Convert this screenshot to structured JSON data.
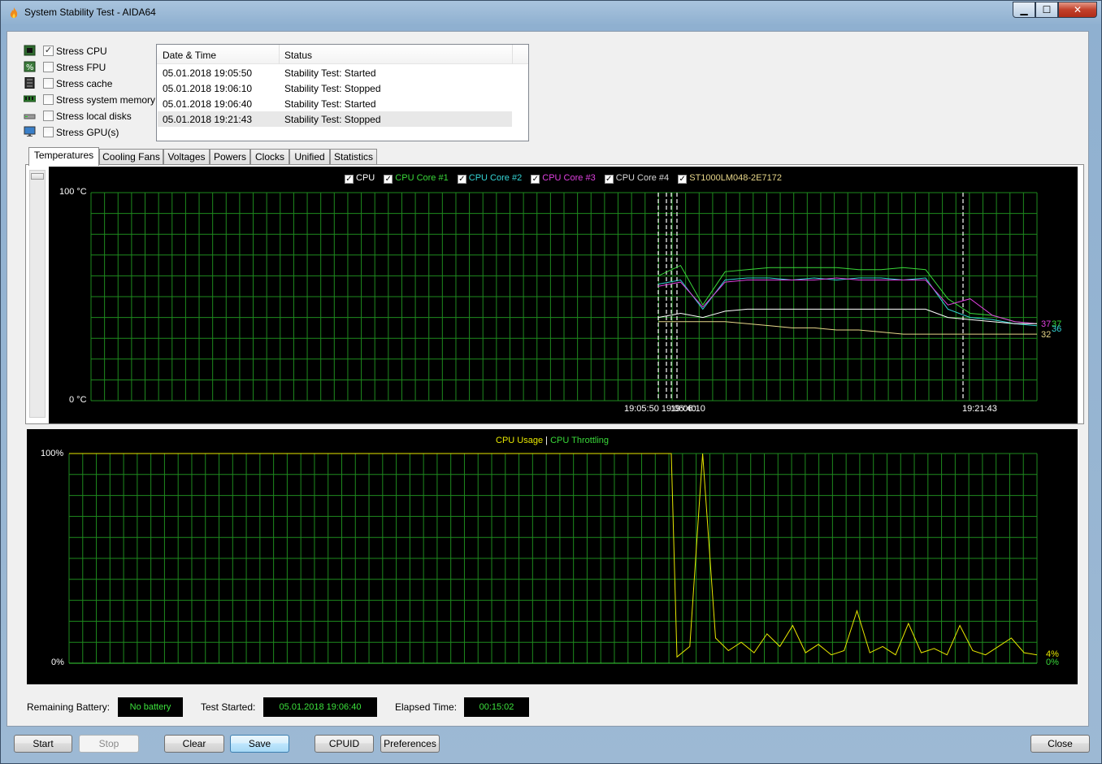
{
  "window": {
    "title": "System Stability Test - AIDA64",
    "controls": {
      "minimize": "▁",
      "maximize": "☐",
      "close": "✕"
    }
  },
  "stress_options": [
    {
      "label": "Stress CPU",
      "checked": true,
      "icon": "cpu-chip-icon"
    },
    {
      "label": "Stress FPU",
      "checked": false,
      "icon": "fpu-icon"
    },
    {
      "label": "Stress cache",
      "checked": false,
      "icon": "cache-icon"
    },
    {
      "label": "Stress system memory",
      "checked": false,
      "icon": "memory-module-icon"
    },
    {
      "label": "Stress local disks",
      "checked": false,
      "icon": "disk-drive-icon"
    },
    {
      "label": "Stress GPU(s)",
      "checked": false,
      "icon": "monitor-gpu-icon"
    }
  ],
  "log": {
    "columns": [
      "Date & Time",
      "Status"
    ],
    "rows": [
      {
        "datetime": "05.01.2018 19:05:50",
        "status": "Stability Test: Started"
      },
      {
        "datetime": "05.01.2018 19:06:10",
        "status": "Stability Test: Stopped"
      },
      {
        "datetime": "05.01.2018 19:06:40",
        "status": "Stability Test: Started"
      },
      {
        "datetime": "05.01.2018 19:21:43",
        "status": "Stability Test: Stopped"
      }
    ]
  },
  "tabs": [
    "Temperatures",
    "Cooling Fans",
    "Voltages",
    "Powers",
    "Clocks",
    "Unified",
    "Statistics"
  ],
  "active_tab": "Temperatures",
  "colors": {
    "grid": "#1e8a1e",
    "cpu": "#ffffff",
    "core1": "#39d839",
    "core2": "#35d5d5",
    "core3": "#e040e0",
    "core4": "#d8d8d8",
    "disk": "#e8d78a",
    "usage": "#e8e800",
    "throttling": "#39d839",
    "status_text": "#3ce23c"
  },
  "chart_data": [
    {
      "type": "line",
      "title": "",
      "ylabel": "",
      "y_top_label": "100 °C",
      "y_bottom_label": "0 °C",
      "ylim": [
        0,
        100
      ],
      "x_time_labels": [
        "19:05:50",
        "19:06:40",
        "19:06:10",
        "19:21:43"
      ],
      "x_tick_label_text": {
        "overlap": "19:05:50 19:06:40",
        "mid": "19:06:10",
        "end": "19:21:43"
      },
      "legend": [
        {
          "name": "CPU",
          "checked": true
        },
        {
          "name": "CPU Core #1",
          "checked": true
        },
        {
          "name": "CPU Core #2",
          "checked": true
        },
        {
          "name": "CPU Core #3",
          "checked": true
        },
        {
          "name": "CPU Core #4",
          "checked": true
        },
        {
          "name": "ST1000LM048-2E7172",
          "checked": true
        }
      ],
      "series": [
        {
          "name": "CPU Core #1",
          "values": [
            60,
            65,
            46,
            62,
            63,
            64,
            64,
            64,
            64,
            63,
            63,
            64,
            63,
            49,
            42,
            41,
            38,
            37
          ]
        },
        {
          "name": "CPU Core #2",
          "values": [
            56,
            58,
            44,
            58,
            59,
            59,
            58,
            59,
            58,
            59,
            59,
            58,
            59,
            44,
            40,
            39,
            37,
            36
          ]
        },
        {
          "name": "CPU Core #3",
          "values": [
            55,
            57,
            45,
            57,
            58,
            58,
            58,
            58,
            59,
            58,
            58,
            58,
            58,
            46,
            49,
            41,
            38,
            37
          ]
        },
        {
          "name": "CPU",
          "values": [
            40,
            42,
            40,
            43,
            44,
            44,
            44,
            44,
            44,
            44,
            44,
            44,
            44,
            40,
            39,
            38,
            37,
            37
          ]
        },
        {
          "name": "ST1000LM048-2E7172",
          "values": [
            38,
            38,
            38,
            38,
            37,
            36,
            35,
            35,
            34,
            34,
            33,
            32,
            32,
            32,
            32,
            32,
            32,
            32
          ]
        }
      ],
      "end_labels": [
        "37",
        "37",
        "36",
        "36",
        "32"
      ]
    },
    {
      "type": "line",
      "title": "",
      "legend": [
        {
          "name": "CPU Usage"
        },
        {
          "name": "CPU Throttling"
        }
      ],
      "y_top_label": "100%",
      "y_bottom_label": "0%",
      "ylim": [
        0,
        100
      ],
      "series": [
        {
          "name": "CPU Usage",
          "values": [
            100,
            100,
            100,
            100,
            100,
            100,
            100,
            100,
            100,
            100,
            100,
            100,
            3,
            8,
            100,
            12,
            6,
            10,
            5,
            14,
            8,
            18,
            5,
            9,
            4,
            6,
            25,
            5,
            8,
            4,
            19,
            5,
            7,
            4,
            18,
            6,
            4,
            8,
            12,
            5,
            4
          ]
        },
        {
          "name": "CPU Throttling",
          "values": [
            0,
            0,
            0,
            0,
            0,
            0,
            0,
            0,
            0,
            0,
            0,
            0,
            0,
            0,
            0,
            0,
            0,
            0,
            0,
            0,
            0,
            0,
            0,
            0,
            0,
            0,
            0,
            0,
            0,
            0,
            0,
            0,
            0,
            0,
            0,
            0,
            0,
            0,
            0,
            0,
            0
          ]
        }
      ],
      "end_labels": {
        "usage": "4%",
        "throttling": "0%"
      }
    }
  ],
  "status": {
    "battery_label": "Remaining Battery:",
    "battery_value": "No battery",
    "started_label": "Test Started:",
    "started_value": "05.01.2018 19:06:40",
    "elapsed_label": "Elapsed Time:",
    "elapsed_value": "00:15:02"
  },
  "buttons": {
    "start": "Start",
    "stop": "Stop",
    "clear": "Clear",
    "save": "Save",
    "cpuid": "CPUID",
    "preferences": "Preferences",
    "close": "Close"
  }
}
